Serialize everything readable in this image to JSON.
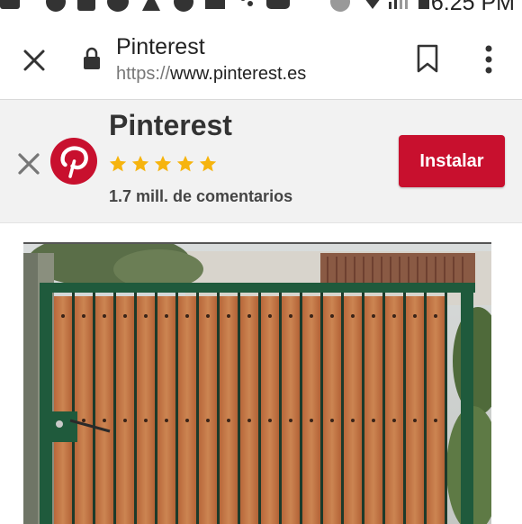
{
  "status_bar": {
    "time": "6:25 PM"
  },
  "toolbar": {
    "title": "Pinterest",
    "url_scheme": "https://",
    "url_host": "www.pinterest.es"
  },
  "banner": {
    "app_name": "Pinterest",
    "rating": 5,
    "reviews": "1.7 mill. de comentarios",
    "install_label": "Instalar",
    "accent_color": "#c8102e",
    "star_color": "#f6b40e"
  },
  "content": {
    "image_subject": "wooden-slat-gate-photo"
  }
}
